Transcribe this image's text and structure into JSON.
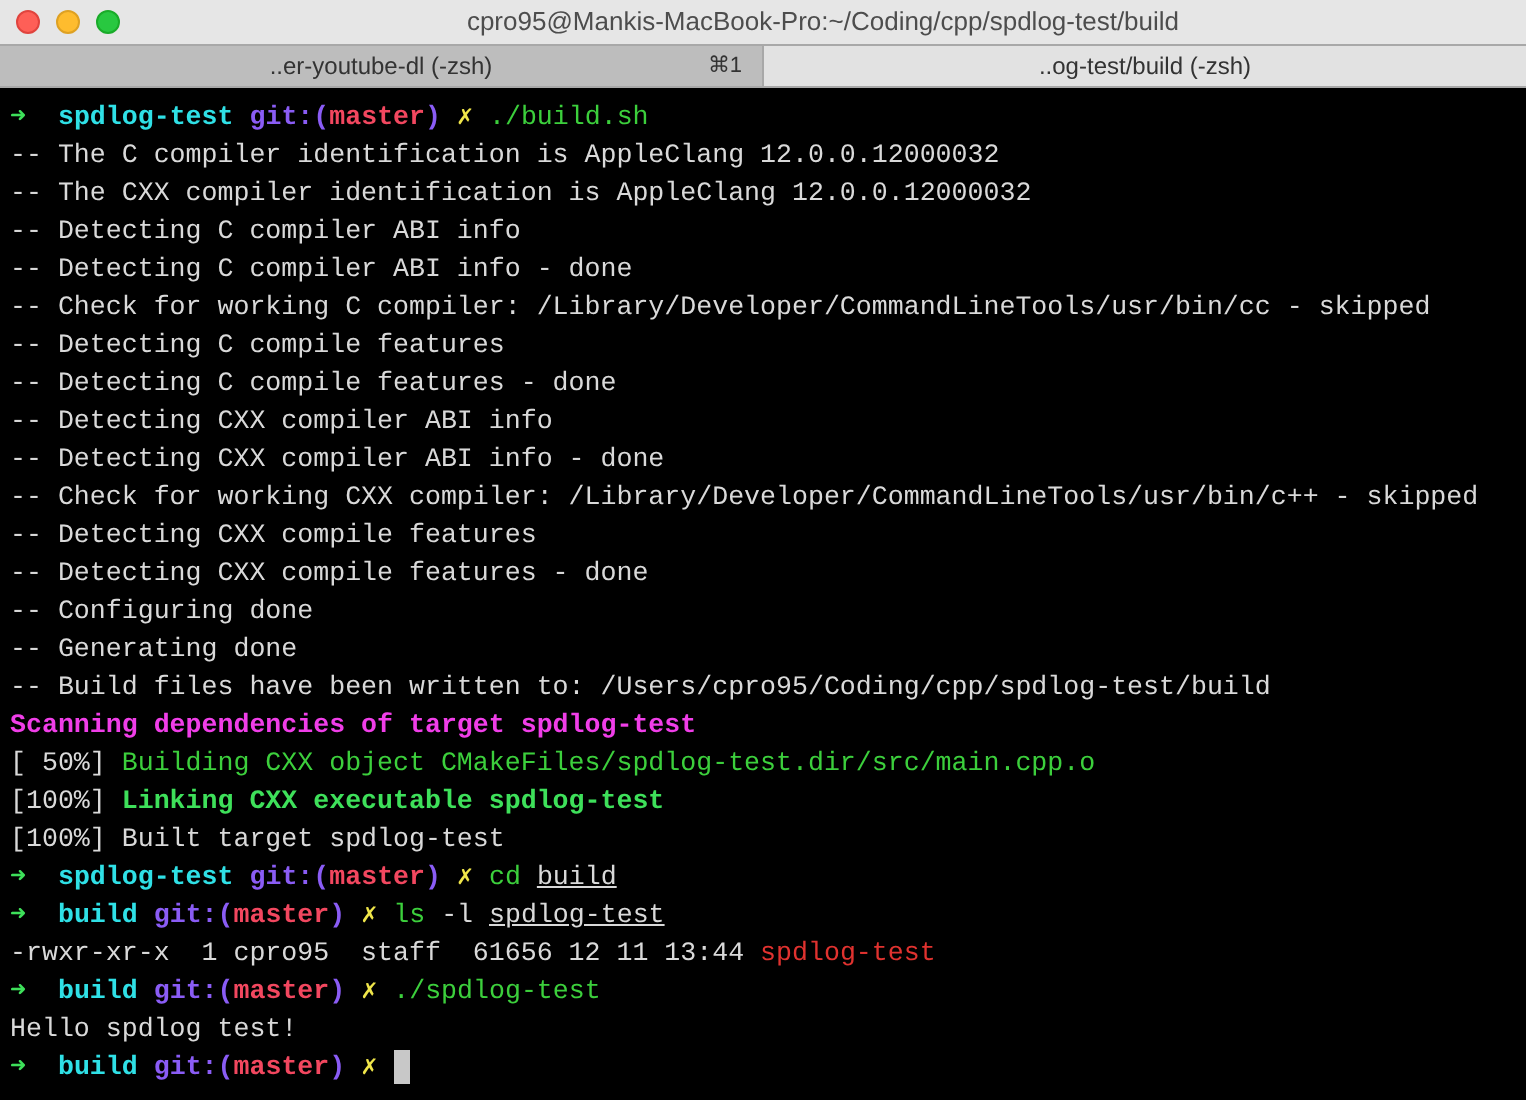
{
  "window": {
    "title": "cpro95@Mankis-MacBook-Pro:~/Coding/cpp/spdlog-test/build"
  },
  "tabs": [
    {
      "label": "..er-youtube-dl (-zsh)",
      "shortcut": "⌘1",
      "selected": false
    },
    {
      "label": "..og-test/build (-zsh)",
      "selected": true
    }
  ],
  "lines": [
    {
      "segments": [
        {
          "kind": "arrow",
          "text": "➜"
        },
        {
          "kind": "dir",
          "text": "  spdlog-test"
        },
        {
          "kind": "git",
          "text": " git:("
        },
        {
          "kind": "branch",
          "text": "master"
        },
        {
          "kind": "git",
          "text": ")"
        },
        {
          "kind": "dirty",
          "text": " ✗"
        },
        {
          "kind": "command",
          "text": " ./build.sh"
        }
      ]
    },
    {
      "segments": [
        {
          "kind": "output",
          "text": "-- The C compiler identification is AppleClang 12.0.0.12000032"
        }
      ]
    },
    {
      "segments": [
        {
          "kind": "output",
          "text": "-- The CXX compiler identification is AppleClang 12.0.0.12000032"
        }
      ]
    },
    {
      "segments": [
        {
          "kind": "output",
          "text": "-- Detecting C compiler ABI info"
        }
      ]
    },
    {
      "segments": [
        {
          "kind": "output",
          "text": "-- Detecting C compiler ABI info - done"
        }
      ]
    },
    {
      "segments": [
        {
          "kind": "output",
          "text": "-- Check for working C compiler: /Library/Developer/CommandLineTools/usr/bin/cc - skipped"
        }
      ]
    },
    {
      "segments": [
        {
          "kind": "output",
          "text": "-- Detecting C compile features"
        }
      ]
    },
    {
      "segments": [
        {
          "kind": "output",
          "text": "-- Detecting C compile features - done"
        }
      ]
    },
    {
      "segments": [
        {
          "kind": "output",
          "text": "-- Detecting CXX compiler ABI info"
        }
      ]
    },
    {
      "segments": [
        {
          "kind": "output",
          "text": "-- Detecting CXX compiler ABI info - done"
        }
      ]
    },
    {
      "segments": [
        {
          "kind": "output",
          "text": "-- Check for working CXX compiler: /Library/Developer/CommandLineTools/usr/bin/c++ - skipped"
        }
      ]
    },
    {
      "segments": [
        {
          "kind": "output",
          "text": "-- Detecting CXX compile features"
        }
      ]
    },
    {
      "segments": [
        {
          "kind": "output",
          "text": "-- Detecting CXX compile features - done"
        }
      ]
    },
    {
      "segments": [
        {
          "kind": "output",
          "text": "-- Configuring done"
        }
      ]
    },
    {
      "segments": [
        {
          "kind": "output",
          "text": "-- Generating done"
        }
      ]
    },
    {
      "segments": [
        {
          "kind": "output",
          "text": "-- Build files have been written to: /Users/cpro95/Coding/cpp/spdlog-test/build"
        }
      ]
    },
    {
      "segments": [
        {
          "kind": "magenta",
          "text": "Scanning dependencies of target spdlog-test"
        }
      ]
    },
    {
      "segments": [
        {
          "kind": "output",
          "text": "[ 50%] "
        },
        {
          "kind": "green",
          "text": "Building CXX object CMakeFiles/spdlog-test.dir/src/main.cpp.o"
        }
      ]
    },
    {
      "segments": [
        {
          "kind": "output",
          "text": "[100%] "
        },
        {
          "kind": "bright-green",
          "text": "Linking CXX executable spdlog-test"
        }
      ]
    },
    {
      "segments": [
        {
          "kind": "output",
          "text": "[100%] Built target spdlog-test"
        }
      ]
    },
    {
      "segments": [
        {
          "kind": "arrow",
          "text": "➜"
        },
        {
          "kind": "dir",
          "text": "  spdlog-test"
        },
        {
          "kind": "git",
          "text": " git:("
        },
        {
          "kind": "branch",
          "text": "master"
        },
        {
          "kind": "git",
          "text": ")"
        },
        {
          "kind": "dirty",
          "text": " ✗"
        },
        {
          "kind": "command",
          "text": " cd "
        },
        {
          "kind": "path",
          "text": "build"
        }
      ]
    },
    {
      "segments": [
        {
          "kind": "arrow",
          "text": "➜"
        },
        {
          "kind": "dir",
          "text": "  build"
        },
        {
          "kind": "git",
          "text": " git:("
        },
        {
          "kind": "branch",
          "text": "master"
        },
        {
          "kind": "git",
          "text": ")"
        },
        {
          "kind": "dirty",
          "text": " ✗"
        },
        {
          "kind": "command",
          "text": " ls"
        },
        {
          "kind": "output",
          "text": " -l "
        },
        {
          "kind": "path",
          "text": "spdlog-test"
        }
      ]
    },
    {
      "segments": [
        {
          "kind": "output",
          "text": "-rwxr-xr-x  1 cpro95  staff  61656 12 11 13:44 "
        },
        {
          "kind": "red",
          "text": "spdlog-test"
        }
      ]
    },
    {
      "segments": [
        {
          "kind": "arrow",
          "text": "➜"
        },
        {
          "kind": "dir",
          "text": "  build"
        },
        {
          "kind": "git",
          "text": " git:("
        },
        {
          "kind": "branch",
          "text": "master"
        },
        {
          "kind": "git",
          "text": ")"
        },
        {
          "kind": "dirty",
          "text": " ✗"
        },
        {
          "kind": "command",
          "text": " ./spdlog-test"
        }
      ]
    },
    {
      "segments": [
        {
          "kind": "output",
          "text": "Hello spdlog test!"
        }
      ]
    },
    {
      "segments": [
        {
          "kind": "arrow",
          "text": "➜"
        },
        {
          "kind": "dir",
          "text": "  build"
        },
        {
          "kind": "git",
          "text": " git:("
        },
        {
          "kind": "branch",
          "text": "master"
        },
        {
          "kind": "git",
          "text": ")"
        },
        {
          "kind": "dirty",
          "text": " ✗"
        }
      ],
      "cursor": true
    }
  ]
}
